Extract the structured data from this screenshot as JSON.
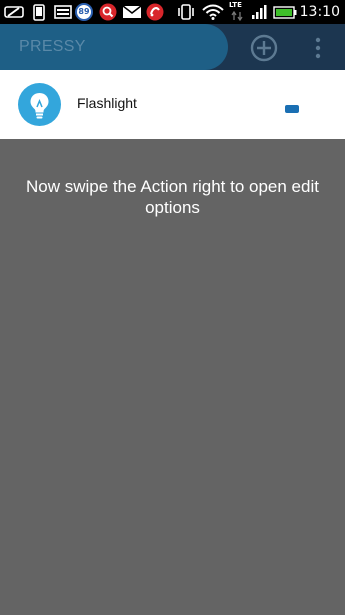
{
  "status_bar": {
    "notification_count": "89",
    "network": "LTE",
    "time": "13:10"
  },
  "app_bar": {
    "title": "PRESSY",
    "add_icon": "add-circle-icon",
    "menu_icon": "more-vert-icon"
  },
  "actions": [
    {
      "label": "Flashlight",
      "icon": "lightbulb-icon"
    }
  ],
  "overlay": {
    "hint": "Now swipe the Action right to open edit options"
  },
  "colors": {
    "status_bar": "#000000",
    "app_bar": "#1c3650",
    "title_pill": "#1e5f86",
    "title_text": "#5a89a8",
    "icon_circle": "#33a6dc",
    "handle": "#1a6fb3",
    "overlay": "#646464"
  }
}
